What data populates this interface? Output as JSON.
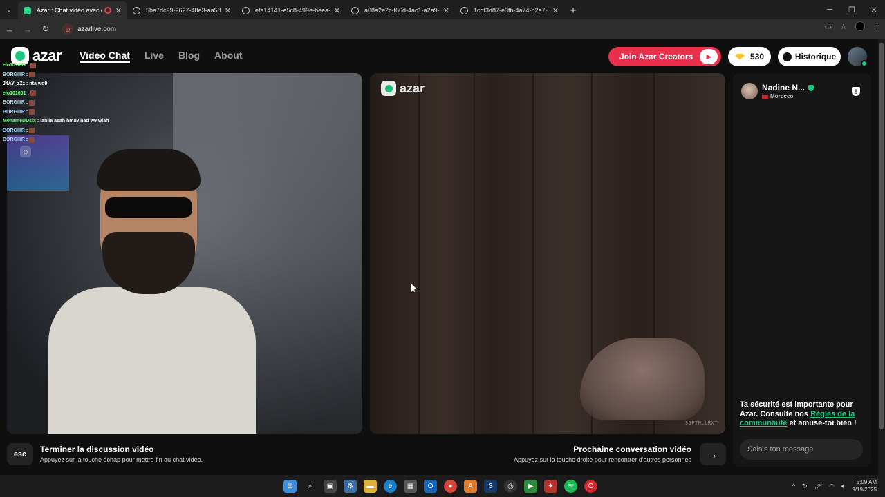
{
  "browser": {
    "tabs": [
      {
        "title": "Azar : Chat vidéo avec de n",
        "active": true
      },
      {
        "title": "5ba7dc99-2627-48e3-aa58-e6f",
        "active": false
      },
      {
        "title": "efa14141-e5c8-499e-beea-950",
        "active": false
      },
      {
        "title": "a08a2e2c-f66d-4ac1-a2a9-e90",
        "active": false
      },
      {
        "title": "1cdf3d87-e3fb-4a74-b2e7-97b",
        "active": false
      }
    ],
    "url": "azarlive.com"
  },
  "site": {
    "logo": "azar",
    "nav": [
      "Video Chat",
      "Live",
      "Blog",
      "About"
    ],
    "creators_label": "Join Azar Creators",
    "gems": "530",
    "history_label": "Historique"
  },
  "chat_overlay": [
    {
      "user": "elo101001",
      "msg": "",
      "color": "green"
    },
    {
      "user": "BORGIIIR",
      "msg": "",
      "color": "blue"
    },
    {
      "user": "J4AY_zZz",
      "msg": "nta wd9",
      "color": "white"
    },
    {
      "user": "elo101001",
      "msg": "",
      "color": "green"
    },
    {
      "user": "BORGIIIR",
      "msg": "",
      "color": "blue"
    },
    {
      "user": "BORGIIIR",
      "msg": "",
      "color": "blue"
    },
    {
      "user": "M0hameDDsix",
      "msg": "lahila asah hma9 had w9 wlah",
      "color": "green"
    },
    {
      "user": "BORGIIIR",
      "msg": "",
      "color": "blue"
    },
    {
      "user": "BORGIIIR",
      "msg": "",
      "color": "blue"
    }
  ],
  "remote_video": {
    "logo": "azar",
    "code": "35PTNLbRXT"
  },
  "peer": {
    "name": "Nadine N...",
    "country": "Morocco"
  },
  "safety": {
    "pre": "Ta sécurité est importante pour Azar. Consulte nos ",
    "link": "Règles de la communauté",
    "post": " et amuse-toi bien !"
  },
  "message_placeholder": "Saisis ton message",
  "bottom": {
    "esc_key": "esc",
    "end_title": "Terminer la discussion vidéo",
    "end_sub": "Appuyez sur la touche échap pour mettre fin au chat vidéo.",
    "next_title": "Prochaine conversation vidéo",
    "next_sub": "Appuyez sur la touche droite pour rencontrer d'autres personnes"
  },
  "taskbar": {
    "time": "5:09 AM",
    "date": "9/19/2025"
  }
}
